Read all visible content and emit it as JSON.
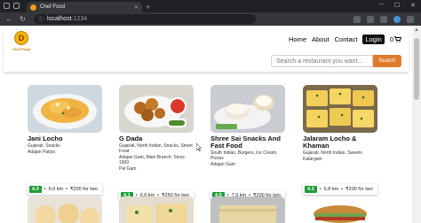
{
  "browser": {
    "tab_title": "Chef Food",
    "url_host": "localhost",
    "url_port": ":1234"
  },
  "header": {
    "logo_text": "Chef Food",
    "logo_letter": "D",
    "nav": [
      "Home",
      "About",
      "Contact",
      "Login"
    ],
    "cart_count": "0"
  },
  "search": {
    "placeholder": "Search a restaurant you want...",
    "button": "Search"
  },
  "restaurants": [
    {
      "name": "Jani Locho",
      "cuisines": "Gujarati, Snacks",
      "area": "Adajan Patiya",
      "rating": "4.3",
      "distance": "6.0 km",
      "cost": "₹200 for two"
    },
    {
      "name": "G Dada",
      "cuisines": "Gujarati, North Indian, Snacks, Street Food",
      "area": "Adajan Gam, Main Branch: Since 1900",
      "extra": "Pal Gam",
      "rating": "4.1",
      "distance": "6.0 km",
      "cost": "₹250 for two"
    },
    {
      "name": "Shree Sai Snacks And Fast Food",
      "cuisines": "South Indian, Burgers, Ice Cream, Pizzas",
      "area": "Adajan Gam",
      "rating": "4.5",
      "distance": "7.9 km",
      "cost": "₹200 for two"
    },
    {
      "name": "Jalaram Locho & Khaman",
      "cuisines": "Gujarati, North Indian, Sweets",
      "area": "Katargam",
      "rating": "4.3",
      "distance": "6.8 km",
      "cost": "₹200 for two"
    }
  ],
  "icons": {
    "cart": "cart-icon",
    "lock": "lock-icon",
    "star": "star-icon"
  },
  "colors": {
    "accent": "#e07b2e",
    "rating_green": "#1f9d3a"
  }
}
